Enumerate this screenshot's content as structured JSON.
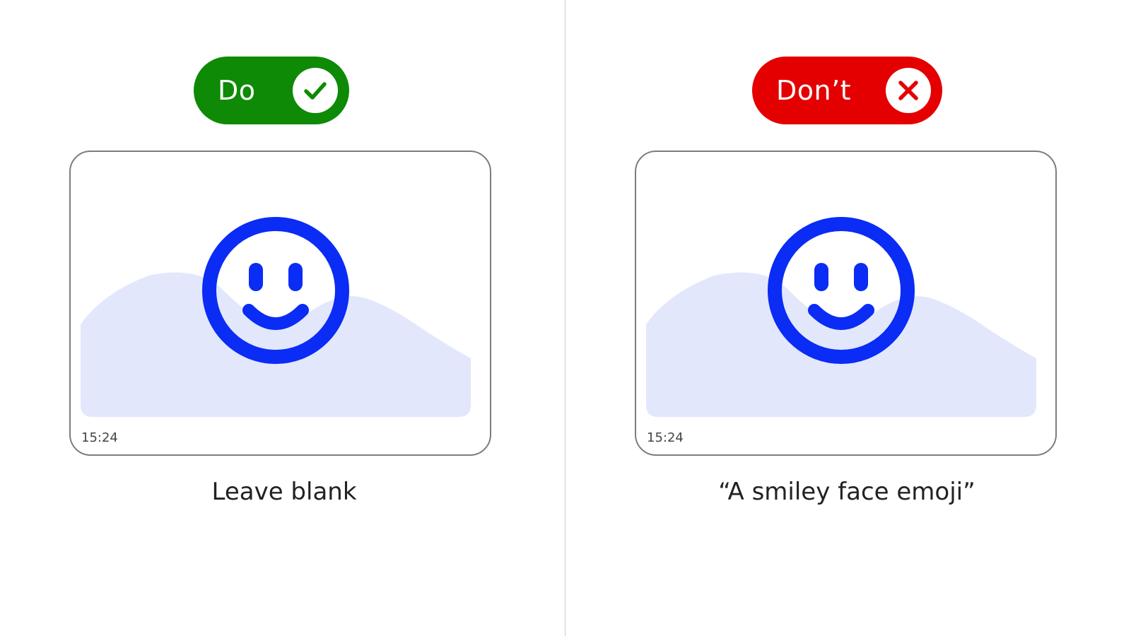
{
  "do_panel": {
    "badge_label": "Do",
    "badge_icon": "checkmark-icon",
    "badge_color": "#0e8a06",
    "image_icon": "smiley-face-icon",
    "timestamp": "15:24",
    "caption": "Leave blank"
  },
  "dont_panel": {
    "badge_label": "Don’t",
    "badge_icon": "cross-icon",
    "badge_color": "#e40000",
    "image_icon": "smiley-face-icon",
    "timestamp": "15:24",
    "caption": "“A smiley face emoji”"
  },
  "colors": {
    "smiley_blue": "#0a2cf5",
    "hill_fill": "#e2e7fc",
    "card_border": "#7d7d7d"
  }
}
